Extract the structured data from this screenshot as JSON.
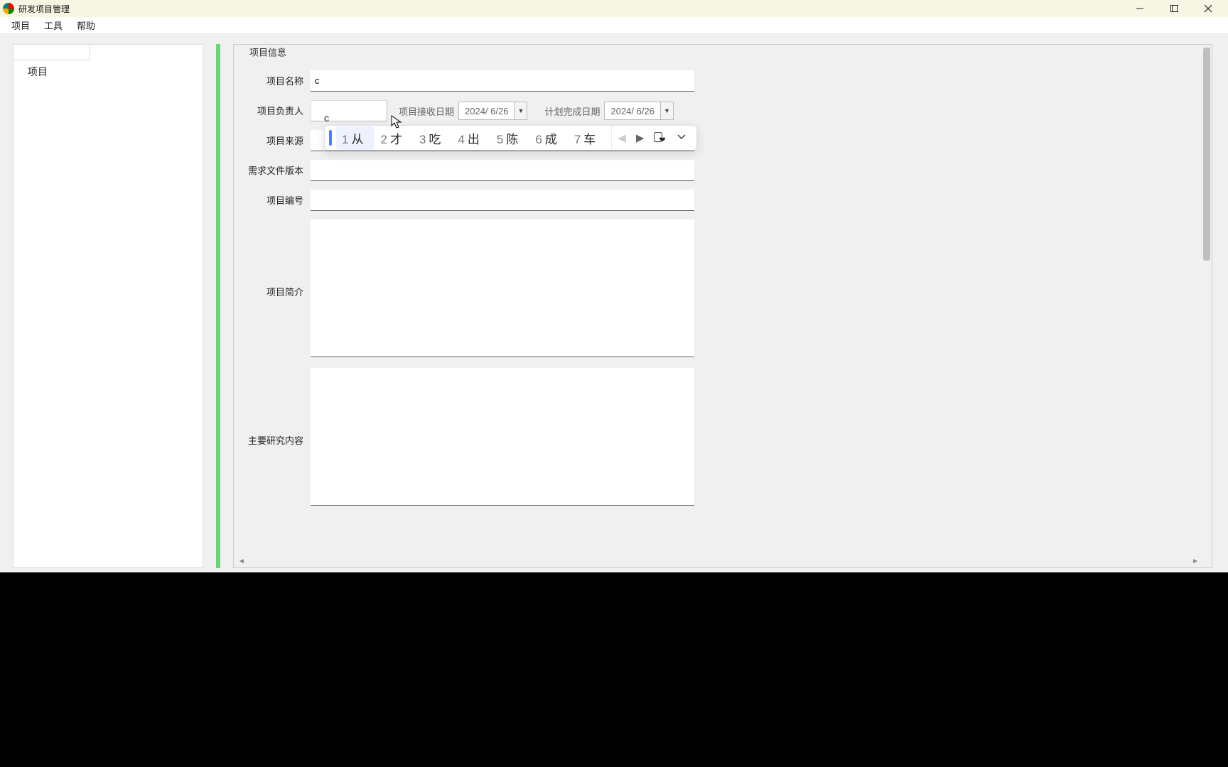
{
  "window": {
    "title": "研发项目管理"
  },
  "menu": {
    "items": [
      "项目",
      "工具",
      "帮助"
    ]
  },
  "sidebar": {
    "root": "项目"
  },
  "form": {
    "legend": "项目信息",
    "labels": {
      "name": "项目名称",
      "owner": "项目负责人",
      "receive_date": "项目接收日期",
      "plan_date": "计划完成日期",
      "source": "项目来源",
      "req_version": "需求文件版本",
      "number": "项目编号",
      "brief": "项目简介",
      "research": "主要研究内容"
    },
    "values": {
      "name": "c",
      "owner": "",
      "receive_date": "2024/ 6/26",
      "plan_date": "2024/ 6/26",
      "source": "",
      "req_version": "",
      "number": "",
      "brief": "",
      "research": ""
    }
  },
  "ime": {
    "candidates": [
      {
        "n": "1",
        "t": "从"
      },
      {
        "n": "2",
        "t": "才"
      },
      {
        "n": "3",
        "t": "吃"
      },
      {
        "n": "4",
        "t": "出"
      },
      {
        "n": "5",
        "t": "陈"
      },
      {
        "n": "6",
        "t": "成"
      },
      {
        "n": "7",
        "t": "车"
      }
    ]
  }
}
